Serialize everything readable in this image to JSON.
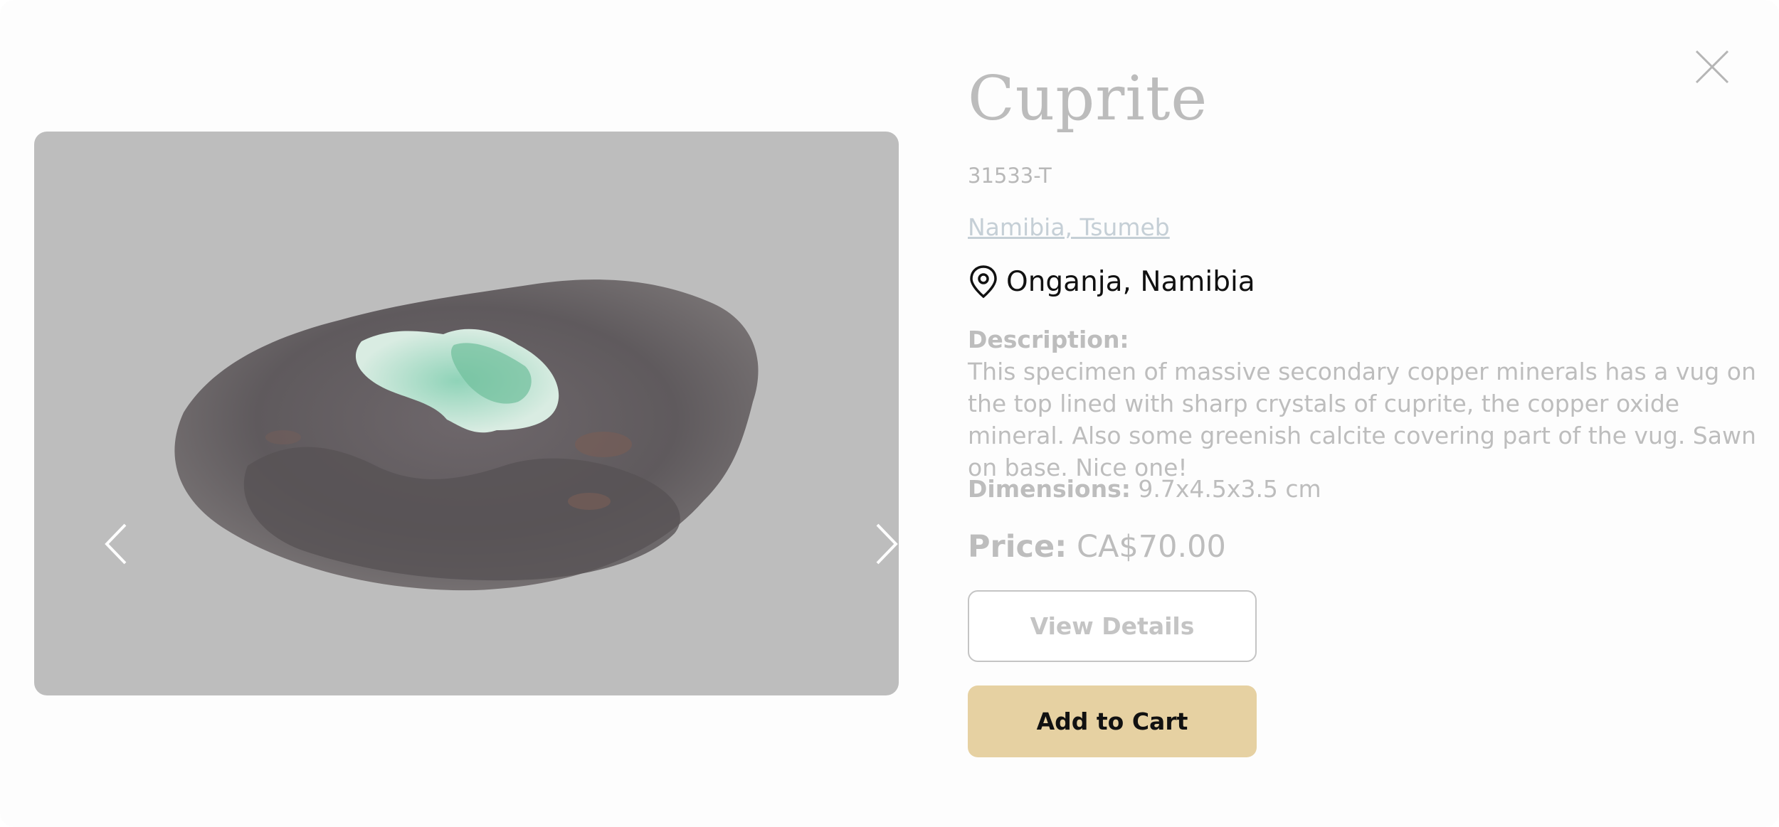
{
  "product": {
    "title": "Cuprite",
    "sku": "31533-T",
    "region_link": "Namibia, Tsumeb",
    "locality": "Onganja, Namibia",
    "description_label": "Description:",
    "description": "This specimen of massive secondary copper minerals has a vug on the top lined with sharp crystals of cuprite, the copper oxide mineral. Also some greenish calcite covering part of the vug. Sawn on base. Nice one!",
    "dimensions_label": "Dimensions:",
    "dimensions_value": "9.7x4.5x3.5 cm",
    "price_label": "Price:",
    "price_value": "CA$70.00"
  },
  "actions": {
    "view_details": "View Details",
    "add_to_cart": "Add to Cart"
  },
  "gallery": {
    "image_count": 5,
    "active_index": 0
  },
  "icons": {
    "close": "close-icon",
    "prev": "chevron-left-icon",
    "next": "chevron-right-icon",
    "location": "map-pin-icon"
  },
  "colors": {
    "accent_button": "#e6d1a2",
    "overlay": "#bdbdbd"
  }
}
